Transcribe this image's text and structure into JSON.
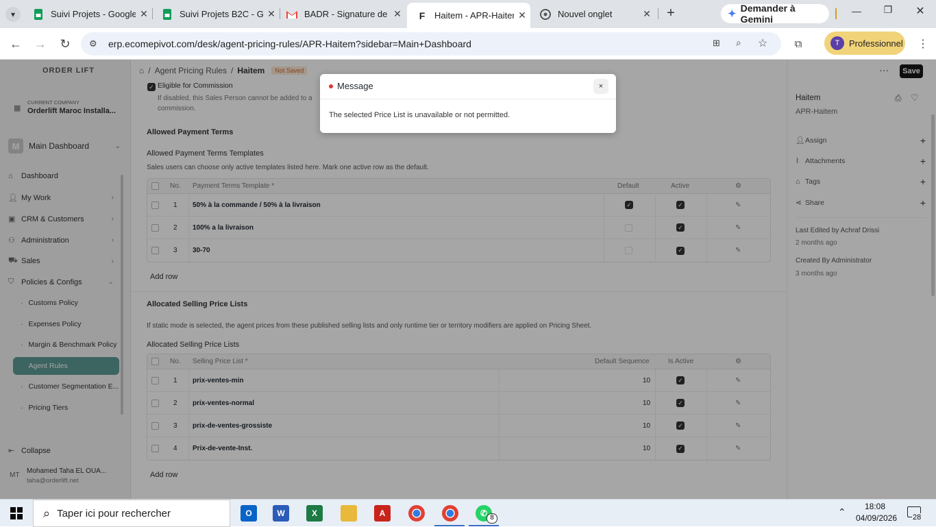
{
  "browser": {
    "tabs": [
      {
        "title": "Suivi Projets - Google",
        "icon": "google-sheets-icon",
        "color": "#0f9d58"
      },
      {
        "title": "Suivi Projets B2C - Go",
        "icon": "google-sheets-icon",
        "color": "#0f9d58"
      },
      {
        "title": "BADR - Signature de",
        "icon": "gmail-icon",
        "color": "#ea4335"
      },
      {
        "title": "Haitem - APR-Haitem",
        "icon": "frappe-icon",
        "color": "#111111"
      },
      {
        "title": "Nouvel onglet",
        "icon": "chrome-icon",
        "color": "#555555"
      }
    ],
    "gemini_label": "Demander à Gemini",
    "url": "erp.ecomepivot.com/desk/agent-pricing-rules/APR-Haitem?sidebar=Main+Dashboard",
    "profile_initial": "T",
    "profile_label": "Professionnel"
  },
  "app": {
    "logo_text": "ORDER LIFT",
    "company_label": "CURRENT COMPANY",
    "company_name": "Orderlift Maroc Installa...",
    "workspace_initial": "M",
    "workspace_name": "Main Dashboard",
    "nav": [
      {
        "label": "Dashboard",
        "icon": "home-icon"
      },
      {
        "label": "My Work",
        "icon": "user-icon"
      },
      {
        "label": "CRM & Customers",
        "icon": "crm-icon"
      },
      {
        "label": "Administration",
        "icon": "users-icon"
      },
      {
        "label": "Sales",
        "icon": "cart-icon"
      },
      {
        "label": "Policies & Configs",
        "icon": "shield-icon"
      }
    ],
    "subnav": [
      "Customs Policy",
      "Expenses Policy",
      "Margin & Benchmark Policy",
      "Agent Rules",
      "Customer Segmentation E...",
      "Pricing Tiers"
    ],
    "collapse_label": "Collapse",
    "user_initials": "MT",
    "user_name": "Mohamed Taha EL OUA...",
    "user_email": "taha@orderlift.net",
    "breadcrumb": {
      "parent": "Agent Pricing Rules",
      "sep": "/",
      "current": "Haitem",
      "status": "Not Saved"
    },
    "save_label": "Save",
    "more_label": "···",
    "commission": {
      "label": "Eligible for Commission",
      "desc1": "If disabled, this Sales Person cannot be added to a",
      "desc2": "commission."
    },
    "payment": {
      "section_title": "Allowed Payment Terms",
      "sub_title": "Allowed Payment Terms Templates",
      "desc": "Sales users can choose only active templates listed here. Mark one active row as the default.",
      "headers": {
        "no": "No.",
        "template": "Payment Terms Template *",
        "default": "Default",
        "active": "Active"
      },
      "rows": [
        {
          "no": "1",
          "template": "50% à la commande / 50% à la livraison",
          "default": true,
          "active": true
        },
        {
          "no": "2",
          "template": "100% a la livraison",
          "default": false,
          "active": true
        },
        {
          "no": "3",
          "template": "30-70",
          "default": false,
          "active": true
        }
      ],
      "add_row": "Add row"
    },
    "pricelists": {
      "section_title": "Allocated Selling Price Lists",
      "desc": "If static mode is selected, the agent prices from these published selling lists and only runtime tier or territory modifiers are applied on Pricing Sheet.",
      "sub_title": "Allocated Selling Price Lists",
      "headers": {
        "no": "No.",
        "list": "Selling Price List *",
        "seq": "Default Sequence",
        "active": "Is Active"
      },
      "rows": [
        {
          "no": "1",
          "list": "prix-ventes-min",
          "seq": "10",
          "active": true
        },
        {
          "no": "2",
          "list": "prix-ventes-normal",
          "seq": "10",
          "active": true
        },
        {
          "no": "3",
          "list": "prix-de-ventes-grossiste",
          "seq": "10",
          "active": true
        },
        {
          "no": "4",
          "list": "Prix-de-vente-Inst.",
          "seq": "10",
          "active": true
        }
      ],
      "add_row": "Add row"
    },
    "right": {
      "title": "Haitem",
      "subtitle": "APR-Haitem",
      "items": [
        {
          "label": "Assign",
          "icon": "user-icon"
        },
        {
          "label": "Attachments",
          "icon": "paperclip-icon"
        },
        {
          "label": "Tags",
          "icon": "tag-icon"
        },
        {
          "label": "Share",
          "icon": "share-icon"
        }
      ],
      "last_edited": "Last Edited by Achraf Drissi",
      "last_edited_time": "2 months ago",
      "created": "Created By Administrator",
      "created_time": "3 months ago"
    }
  },
  "modal": {
    "title": "Message",
    "body": "The selected Price List is unavailable or not permitted.",
    "close_label": "×"
  },
  "taskbar": {
    "search_placeholder": "Taper ici pour rechercher",
    "time": "18:08",
    "date": "04/09/2026",
    "notif_count": "28",
    "whatsapp_badge": "8"
  }
}
